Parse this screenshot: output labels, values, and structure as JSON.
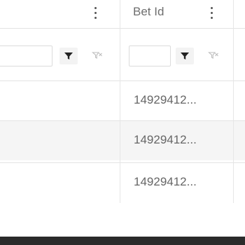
{
  "grid": {
    "columns": [
      {
        "title": ""
      },
      {
        "title": "Bet Id"
      }
    ],
    "rows": [
      {
        "bet_id": "14929412..."
      },
      {
        "bet_id": "14929412..."
      },
      {
        "bet_id": "14929412..."
      }
    ],
    "filters": {
      "col1_value": "",
      "col2_value": ""
    }
  },
  "icons": {
    "menu": "kebab-menu-icon",
    "filter": "filter-icon",
    "clear_filter": "clear-filter-icon"
  },
  "colors": {
    "header_text": "#6e6e6e",
    "cell_text": "#666666",
    "alt_row_bg": "#f5f5f5",
    "bottom_bar": "#2b2b2b"
  }
}
